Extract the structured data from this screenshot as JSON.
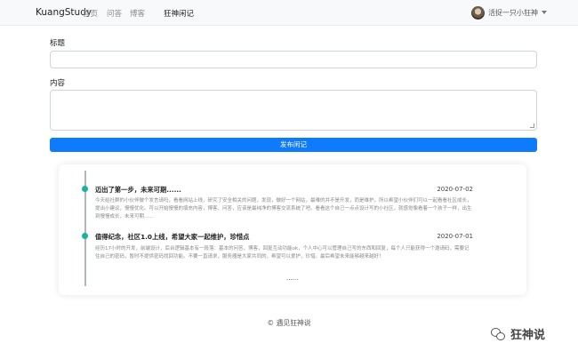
{
  "navbar": {
    "brand": "KuangStudy",
    "links": [
      "首页",
      "问答",
      "博客",
      "狂神闲记"
    ],
    "user": "活捉一只小狂神"
  },
  "form": {
    "title_label": "标题",
    "content_label": "内容",
    "submit_label": "发布闲记"
  },
  "posts": [
    {
      "title": "迈出了第一步，未来可期......",
      "date": "2020-07-02",
      "body": "今天给社群的小伙伴做个发言请吗，看看网站上线，研究了安全相关的问题，发现，做好一个网站，最难的并不是开发，而是维护。所以希望小伙伴们可以一起看看社区成长，提出小建议，慢慢优化。可以开始慢慢的填充内容，博客、问答，应该是最纯净的博客交流系统了吧。看看这个自己一点点设计写的小社区，就感觉像看着一个孩子一样，出生到慢慢成长，未来可期......"
    },
    {
      "title": "值得纪念，社区1.0上线，希望大家一起维护，珍惜点",
      "date": "2020-07-01",
      "body": "经历17小时的开发，前端设计，后台逻辑基本有一段落：基本的问答，博客，回复互动功能ok，个人中心可以管理自己写的东西和回复，每个人只能获得一个邀请码，需要记住自己的密码，暂时不提供密码找回功能。不要一直请求，服务器是大家共同的，希望可以爱护，珍惜。最后希望未来能够越来越好！"
    }
  ],
  "more": "......",
  "footer": "© 遇见狂神说",
  "watermark": "狂神说"
}
